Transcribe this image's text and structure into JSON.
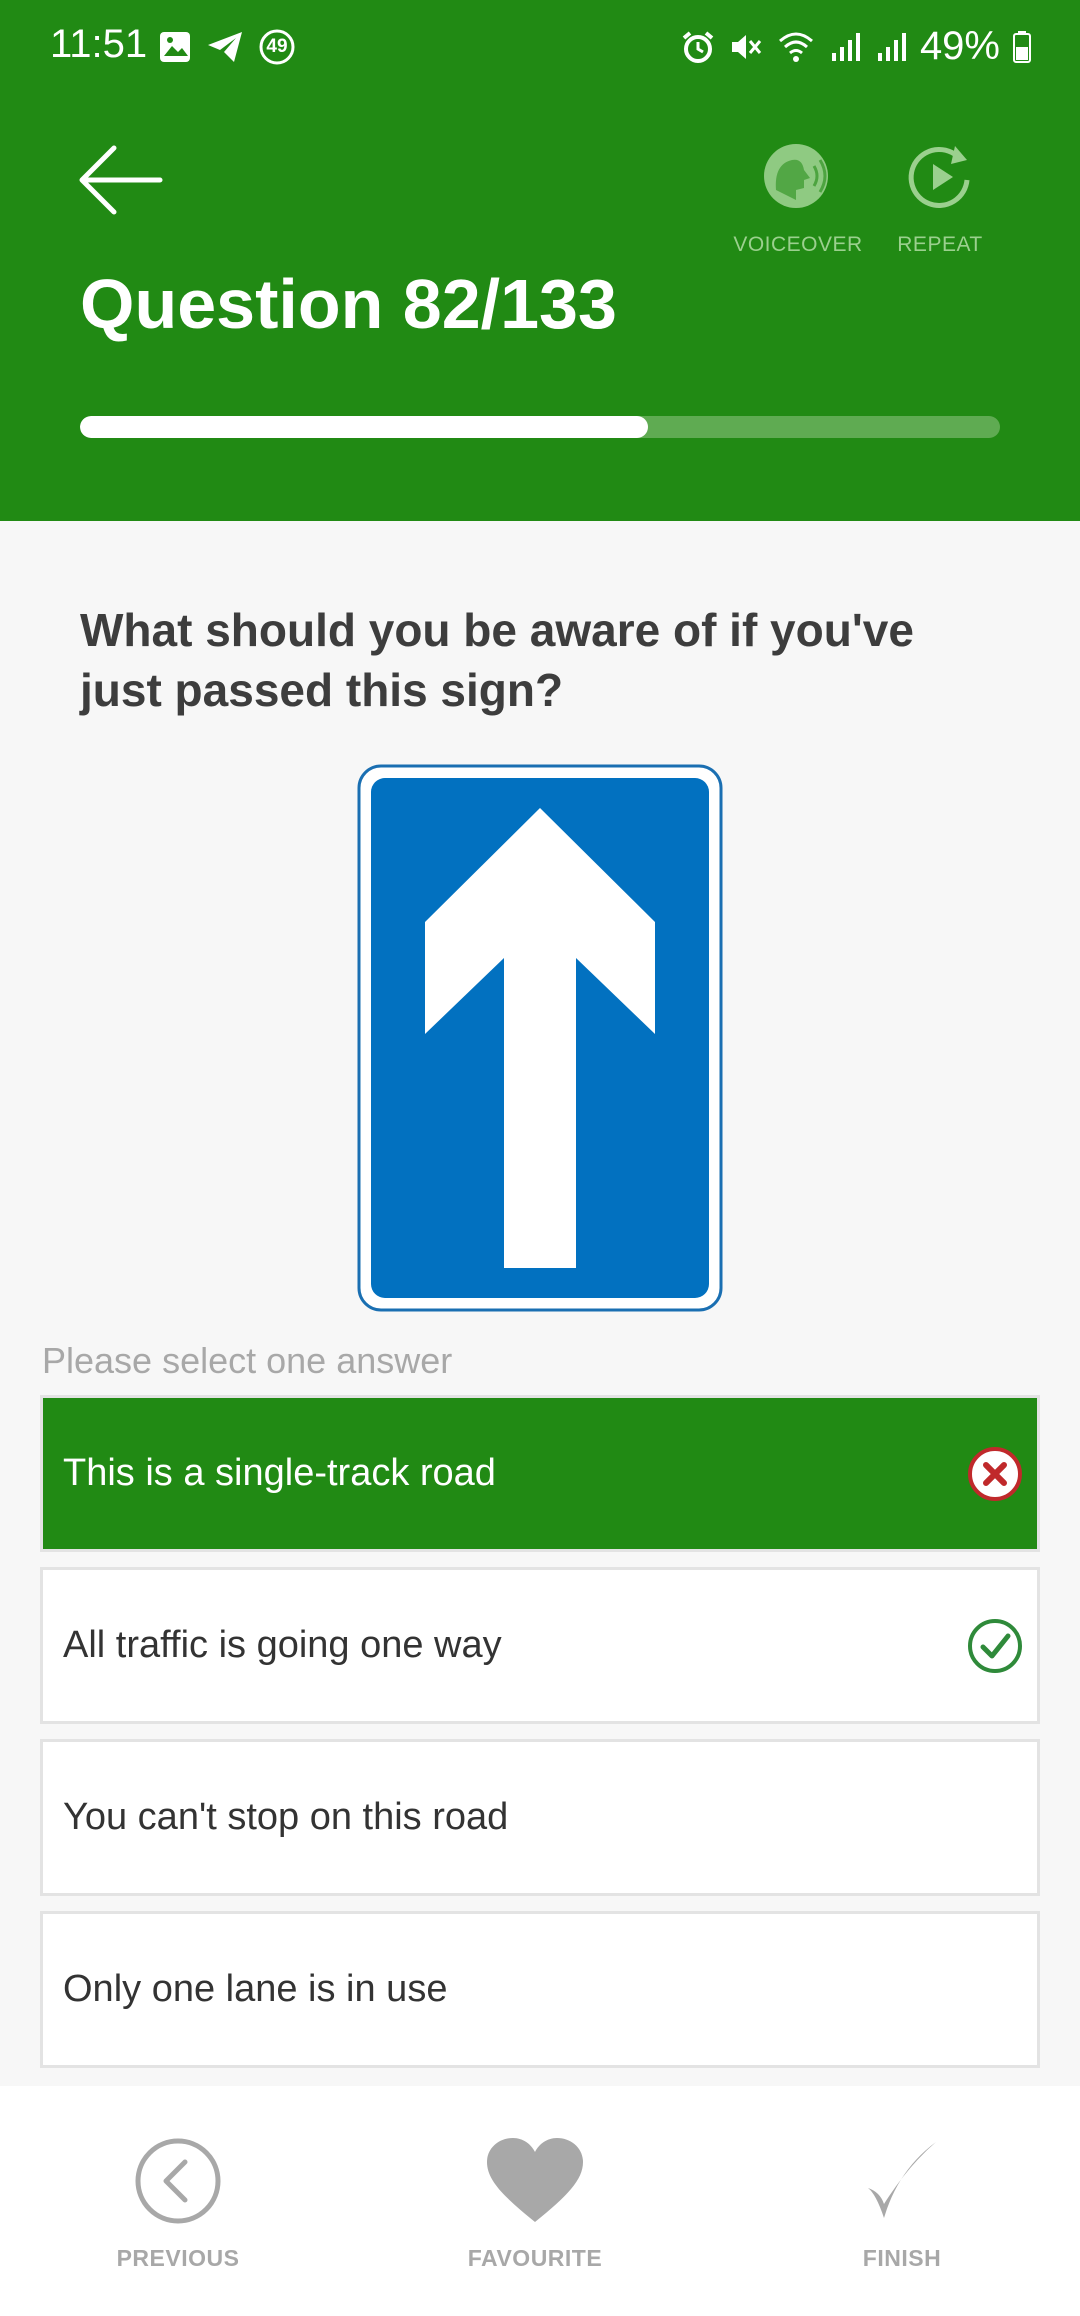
{
  "status_bar": {
    "time": "11:51",
    "notification_count": "49",
    "battery": "49%"
  },
  "header": {
    "back_icon": "arrow-left-icon",
    "voiceover_label": "VOICEOVER",
    "repeat_label": "REPEAT",
    "title": "Question 82/133",
    "progress": 0.617,
    "bg_color": "#218a14"
  },
  "question": {
    "text": "What should you be aware of if you've just passed this sign?",
    "sign": "one-way-traffic-sign"
  },
  "instruction": "Please select one answer",
  "answers": [
    {
      "text": "This is a single-track road",
      "state": "selected-wrong"
    },
    {
      "text": "All traffic is going one way",
      "state": "correct"
    },
    {
      "text": "You can't stop on this road",
      "state": "none"
    },
    {
      "text": "Only one lane is in use",
      "state": "none"
    }
  ],
  "bottom_nav": {
    "previous_label": "PREVIOUS",
    "favourite_label": "FAVOURITE",
    "finish_label": "FINISH"
  }
}
